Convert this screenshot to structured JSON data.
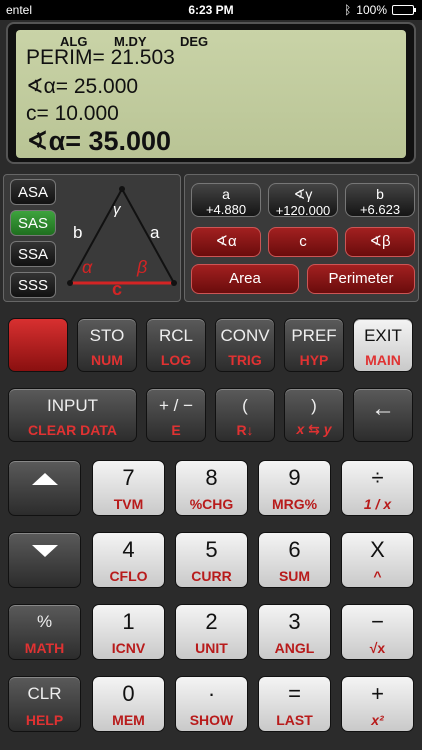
{
  "status": {
    "carrier": "entel",
    "time": "6:23 PM",
    "battery": "100%"
  },
  "display": {
    "indicators": [
      "ALG",
      "M.DY",
      "DEG"
    ],
    "lines": [
      "PERIM= 21.503",
      "∢α= 25.000",
      "c= 10.000"
    ],
    "main": "∢α= 35.000"
  },
  "modes": [
    {
      "label": "ASA",
      "active": false
    },
    {
      "label": "SAS",
      "active": true
    },
    {
      "label": "SSA",
      "active": false
    },
    {
      "label": "SSS",
      "active": false
    }
  ],
  "triangle": {
    "side_a": "a",
    "side_b": "b",
    "side_c": "c",
    "angle_alpha": "α",
    "angle_beta": "β",
    "angle_gamma": "γ"
  },
  "values": [
    {
      "top": "a",
      "bottom": "+4.880"
    },
    {
      "top": "∢γ",
      "bottom": "+120.000"
    },
    {
      "top": "b",
      "bottom": "+6.623"
    }
  ],
  "red_buttons": [
    "∢α",
    "c",
    "∢β"
  ],
  "calc_buttons": [
    "Area",
    "Perimeter"
  ],
  "row1": [
    {
      "cap": "",
      "sub": ""
    },
    {
      "cap": "STO",
      "sub": "NUM"
    },
    {
      "cap": "RCL",
      "sub": "LOG"
    },
    {
      "cap": "CONV",
      "sub": "TRIG"
    },
    {
      "cap": "PREF",
      "sub": "HYP"
    },
    {
      "cap": "EXIT",
      "sub": "MAIN"
    }
  ],
  "row2": [
    {
      "cap": "INPUT",
      "sub": "CLEAR DATA"
    },
    {
      "cap": "+ / −",
      "sub": "E"
    },
    {
      "cap": "(",
      "sub": "R↓"
    },
    {
      "cap": ")",
      "sub": "x ⇆ y"
    },
    {
      "cap": "←",
      "sub": ""
    }
  ],
  "keys": [
    [
      {
        "cap": "",
        "sub": ""
      },
      {
        "cap": "7",
        "sub": "TVM"
      },
      {
        "cap": "8",
        "sub": "%CHG"
      },
      {
        "cap": "9",
        "sub": "MRG%"
      },
      {
        "cap": "÷",
        "sub": "1 / x"
      }
    ],
    [
      {
        "cap": "",
        "sub": ""
      },
      {
        "cap": "4",
        "sub": "CFLO"
      },
      {
        "cap": "5",
        "sub": "CURR"
      },
      {
        "cap": "6",
        "sub": "SUM"
      },
      {
        "cap": "X",
        "sub": "^"
      }
    ],
    [
      {
        "cap": "%",
        "sub": "MATH"
      },
      {
        "cap": "1",
        "sub": "ICNV"
      },
      {
        "cap": "2",
        "sub": "UNIT"
      },
      {
        "cap": "3",
        "sub": "ANGL"
      },
      {
        "cap": "−",
        "sub": "√x"
      }
    ],
    [
      {
        "cap": "CLR",
        "sub": "HELP"
      },
      {
        "cap": "0",
        "sub": "MEM"
      },
      {
        "cap": "·",
        "sub": "SHOW"
      },
      {
        "cap": "=",
        "sub": "LAST"
      },
      {
        "cap": "+",
        "sub": "x²"
      }
    ]
  ]
}
